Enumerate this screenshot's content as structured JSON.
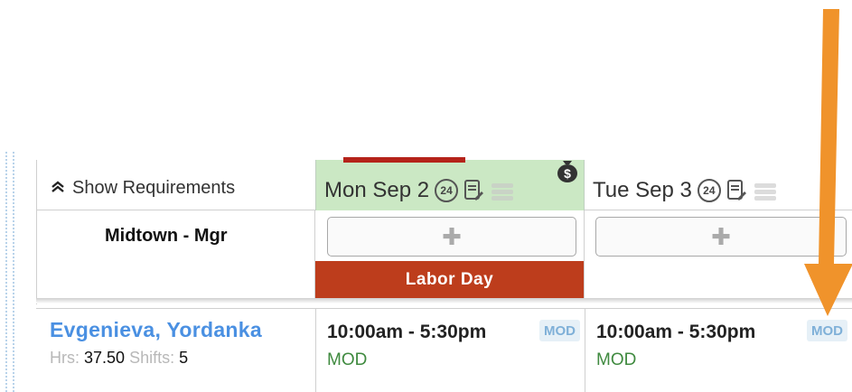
{
  "requirements": {
    "toggle_label": "Show Requirements"
  },
  "days": [
    {
      "label": "Mon Sep 2",
      "icon_24": "24",
      "holiday": "Labor Day"
    },
    {
      "label": "Tue Sep 3",
      "icon_24": "24"
    }
  ],
  "location": {
    "name": "Midtown - Mgr"
  },
  "add_shift_glyph": "✚",
  "employee": {
    "name": "Evgenieva, Yordanka",
    "hrs_label": "Hrs:",
    "hrs_value": "37.50",
    "shifts_label": "Shifts:",
    "shifts_value": "5"
  },
  "shifts": [
    {
      "time": "10:00am - 5:30pm",
      "badge": "MOD",
      "position": "MOD"
    },
    {
      "time": "10:00am - 5:30pm",
      "badge": "MOD",
      "position": "MOD"
    }
  ],
  "colors": {
    "today_header": "#cbe8c4",
    "holiday": "#bd3d1c",
    "employee_name": "#4a90e2",
    "position": "#3f8a3f",
    "arrow": "#f0932b"
  },
  "icons": [
    "chevron-double-up-icon",
    "24-hour-icon",
    "note-edit-icon",
    "stack-icon",
    "money-bag-icon",
    "add-icon",
    "arrow-down-annotation"
  ]
}
